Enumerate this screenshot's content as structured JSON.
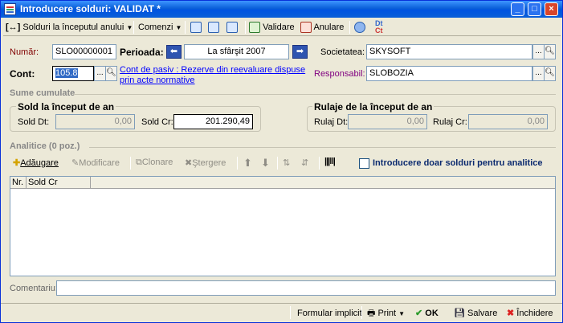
{
  "window": {
    "title": "Introducere solduri: VALIDAT *",
    "min": "_",
    "max": "□",
    "close": "×"
  },
  "toolbar": {
    "solduri_menu": "Solduri la începutul anului",
    "comenzi": "Comenzi",
    "validare": "Validare",
    "anulare": "Anulare"
  },
  "form": {
    "numar_label": "Număr:",
    "numar_value": "SLO00000001",
    "perioada_label": "Perioada:",
    "perioada_value": "La sfârşit 2007",
    "societatea_label": "Societatea:",
    "societatea_value": "SKYSOFT",
    "cont_label": "Cont:",
    "cont_value": "105.8",
    "cont_desc_line1": "Cont de pasiv : Rezerve din reevaluare dispuse",
    "cont_desc_line2": "prin acte normative",
    "responsabil_label": "Responsabil:",
    "responsabil_value": "SLOBOZIA"
  },
  "sume": {
    "section": "Sume cumulate",
    "sold_title": "Sold la început de an",
    "sold_dt_label": "Sold Dt:",
    "sold_dt": "0,00",
    "sold_cr_label": "Sold Cr:",
    "sold_cr": "201.290,49",
    "rulaje_title": "Rulaje de la început de an",
    "rulaj_dt_label": "Rulaj Dt:",
    "rulaj_dt": "0,00",
    "rulaj_cr_label": "Rulaj Cr:",
    "rulaj_cr": "0,00"
  },
  "analitice": {
    "section": "Analitice (0 poz.)",
    "adaugare": "Adăugare",
    "modificare": "Modificare",
    "clonare": "Clonare",
    "stergere": "Ştergere",
    "checkbox_label": "Introducere doar solduri pentru analitice",
    "columns": [
      "Nr.",
      "Sold Cr"
    ]
  },
  "comentariu_label": "Comentariu:",
  "statusbar": {
    "formular": "Formular implicit",
    "print": "Print",
    "ok": "OK",
    "salvare": "Salvare",
    "inchidere": "Închidere"
  },
  "colors": {
    "title_bar": "#0a5fd8",
    "accent": "#2f54b0",
    "label_red": "#800000",
    "label_purple": "#800080"
  }
}
